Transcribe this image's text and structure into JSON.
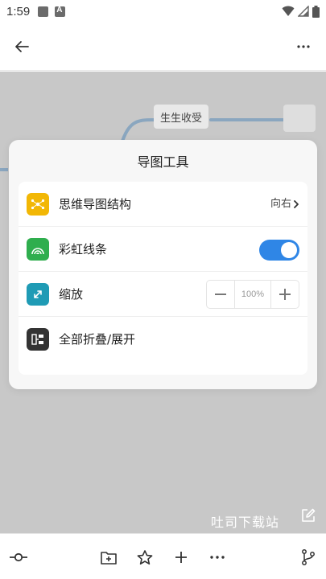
{
  "status_bar": {
    "time": "1:59",
    "icons": [
      "image-icon",
      "a-app-icon",
      "wifi-icon",
      "signal-icon",
      "battery-icon"
    ]
  },
  "app_bar": {
    "back_icon": "arrow-left-icon",
    "more_icon": "more-horizontal-icon"
  },
  "canvas": {
    "node_text": "生生收受",
    "line_color": "#8aa6bf",
    "background": "#c8c8c8"
  },
  "panel": {
    "title": "导图工具",
    "items": [
      {
        "label": "思维导图结构",
        "value": "向右",
        "icon": "structure-icon",
        "color": "#f2b705"
      },
      {
        "label": "彩虹线条",
        "toggle_on": true,
        "icon": "rainbow-icon",
        "color": "#2fae4e"
      },
      {
        "label": "缩放",
        "zoom": "100%",
        "icon": "expand-icon",
        "color": "#1f9bb5"
      },
      {
        "label": "全部折叠/展开",
        "icon": "collapse-icon",
        "color": "#333333"
      }
    ]
  },
  "accent_color": "#2f86e6",
  "watermark": "吐司下载站",
  "bottom_bar": {
    "icons": [
      "topic-node-icon",
      "folder-add-icon",
      "star-icon",
      "plus-icon",
      "more-horizontal-icon",
      "branch-icon"
    ]
  }
}
